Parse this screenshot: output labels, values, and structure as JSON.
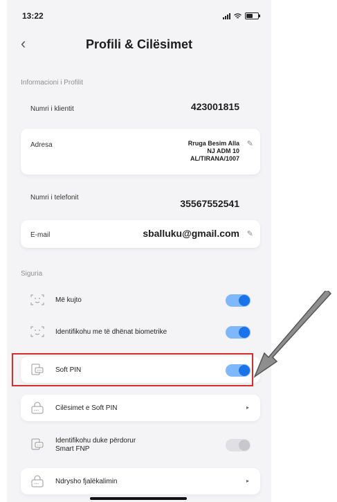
{
  "status": {
    "time": "13:22"
  },
  "header": {
    "title": "Profili & Cilësimet"
  },
  "profile": {
    "section_label": "Informacioni i Profilit",
    "client_number": {
      "label": "Numri i klientit",
      "value": "423001815"
    },
    "address": {
      "label": "Adresa",
      "line1": "Rruga Besim Alla",
      "line2": "NJ ADM 10",
      "line3": "AL/TIRANA/1007"
    },
    "phone": {
      "label": "Numri i telefonit",
      "value": "35567552541"
    },
    "email": {
      "label": "E-mail",
      "value": "sballuku@gmail.com"
    }
  },
  "security": {
    "section_label": "Siguria",
    "remember_me": {
      "label": "Më kujto",
      "enabled": true
    },
    "biometric": {
      "label": "Identifikohu me të dhënat biometrike",
      "enabled": true
    },
    "soft_pin": {
      "label": "Soft PIN",
      "enabled": true
    },
    "soft_pin_settings": {
      "label": "Cilësimet e Soft PIN"
    },
    "smart_fnp": {
      "label_line1": "Identifikohu duke përdorur",
      "label_line2": "Smart FNP",
      "enabled": false
    },
    "change_password": {
      "label": "Ndrysho fjalëkalimin"
    }
  },
  "colors": {
    "highlight": "#d92b2b",
    "toggle_on": "#1a73e8",
    "arrow": "#888888"
  }
}
